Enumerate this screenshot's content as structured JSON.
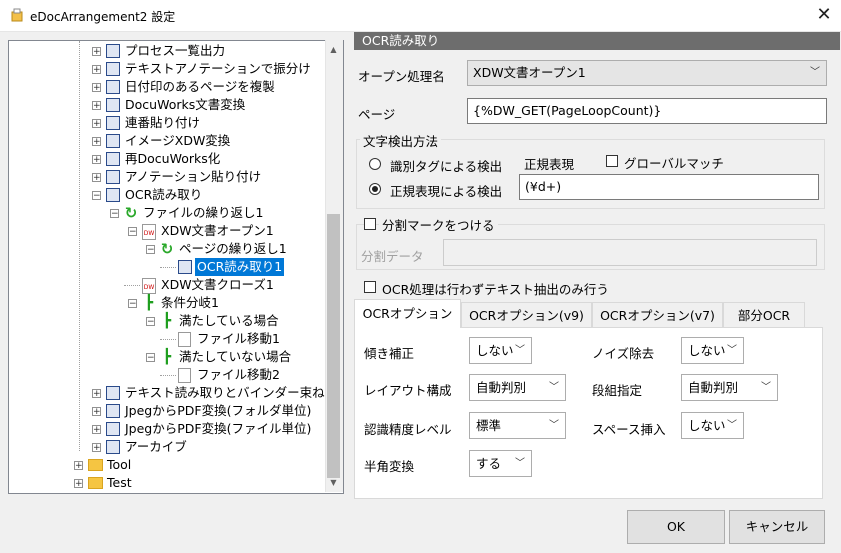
{
  "window": {
    "title": "eDocArrangement2 設定",
    "icon": "app-icon",
    "close_icon": "close-icon"
  },
  "tree": {
    "items": [
      {
        "label": "プロセス一覧出力"
      },
      {
        "label": "テキストアノテーションで振分け"
      },
      {
        "label": "日付印のあるページを複製"
      },
      {
        "label": "DocuWorks文書変換"
      },
      {
        "label": "連番貼り付け"
      },
      {
        "label": "イメージXDW変換"
      },
      {
        "label": "再DocuWorks化"
      },
      {
        "label": "アノテーション貼り付け"
      },
      {
        "label": "OCR読み取り"
      },
      {
        "label": "ファイルの繰り返し1"
      },
      {
        "label": "XDW文書オープン1"
      },
      {
        "label": "ページの繰り返し1"
      },
      {
        "label": "OCR読み取り1",
        "selected": true
      },
      {
        "label": "XDW文書クローズ1"
      },
      {
        "label": "条件分岐1"
      },
      {
        "label": "満たしている場合"
      },
      {
        "label": "ファイル移動1"
      },
      {
        "label": "満たしていない場合"
      },
      {
        "label": "ファイル移動2"
      },
      {
        "label": "テキスト読み取りとバインダー束ね"
      },
      {
        "label": "JpegからPDF変換(フォルダ単位)"
      },
      {
        "label": "JpegからPDF変換(ファイル単位)"
      },
      {
        "label": "アーカイブ"
      },
      {
        "label": "Tool"
      },
      {
        "label": "Test"
      }
    ]
  },
  "panel": {
    "header": "OCR読み取り",
    "open_process_label": "オープン処理名",
    "open_process_value": "XDW文書オープン1",
    "page_label": "ページ",
    "page_value": "{%DW_GET(PageLoopCount)}",
    "detect_group_title": "文字検出方法",
    "radio_tag": "識別タグによる検出",
    "radio_regex": "正規表現による検出",
    "regex_label": "正規表現",
    "global_match_label": "グローバルマッチ",
    "regex_value": "(¥d+)",
    "split_mark_label": "分割マークをつける",
    "split_data_label": "分割データ",
    "text_only_label": "OCR処理は行わずテキスト抽出のみ行う"
  },
  "tabs": [
    "OCRオプション",
    "OCRオプション(v9)",
    "OCRオプション(v7)",
    "部分OCR"
  ],
  "ocr_options": {
    "deskew_label": "傾き補正",
    "deskew_value": "しない",
    "noise_label": "ノイズ除去",
    "noise_value": "しない",
    "layout_label": "レイアウト構成",
    "layout_value": "自動判別",
    "column_label": "段組指定",
    "column_value": "自動判別",
    "accuracy_label": "認識精度レベル",
    "accuracy_value": "標準",
    "space_label": "スペース挿入",
    "space_value": "しない",
    "halfwidth_label": "半角変換",
    "halfwidth_value": "する"
  },
  "buttons": {
    "ok": "OK",
    "cancel": "キャンセル"
  }
}
